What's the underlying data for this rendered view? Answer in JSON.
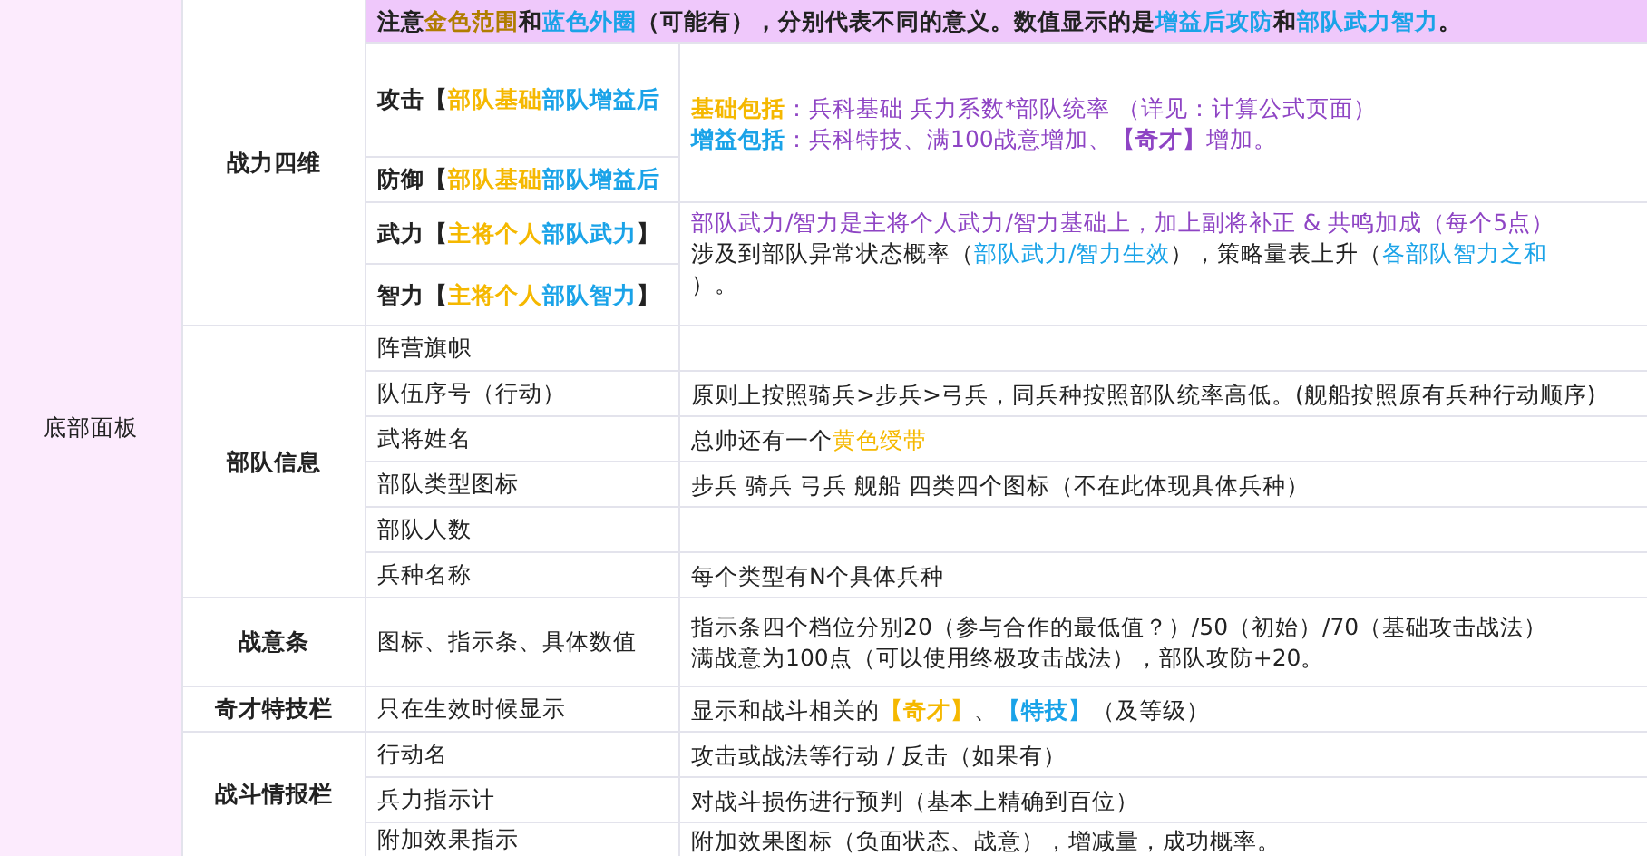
{
  "section": {
    "label": "底部面板"
  },
  "groups": [
    {
      "label": "战力四维",
      "note": [
        {
          "text": "注意",
          "color": "#222222",
          "bold": true
        },
        {
          "text": "金色范围",
          "color": "#b07d00",
          "bold": true
        },
        {
          "text": "和",
          "color": "#222222",
          "bold": true
        },
        {
          "text": "蓝色外圈",
          "color": "#1aa3e8",
          "bold": true
        },
        {
          "text": "（可能有），分别代表不同的意义。数值显示的是",
          "color": "#222222",
          "bold": true
        },
        {
          "text": "增益后攻防",
          "color": "#1aa3e8",
          "bold": true
        },
        {
          "text": "和",
          "color": "#222222",
          "bold": true
        },
        {
          "text": "部队武力智力",
          "color": "#1aa3e8",
          "bold": true
        },
        {
          "text": "。",
          "color": "#222222",
          "bold": true
        }
      ],
      "blocks": [
        {
          "items": [
            [
              {
                "text": "攻击【",
                "color": "#222222",
                "bold": true
              },
              {
                "text": "部队基础 ",
                "color": "#f5b800",
                "bold": true
              },
              {
                "text": "部队增益后",
                "color": "#1aa3e8",
                "bold": true
              }
            ],
            [
              {
                "text": "防御【",
                "color": "#222222",
                "bold": true
              },
              {
                "text": "部队基础 ",
                "color": "#f5b800",
                "bold": true
              },
              {
                "text": "部队增益后",
                "color": "#1aa3e8",
                "bold": true
              }
            ]
          ],
          "lines": [
            [
              {
                "text": "基础包括",
                "color": "#f5b800",
                "bold": true
              },
              {
                "text": "：兵科基础 兵力系数*部队统率 （详见：计算公式页面）",
                "color": "#8e44c4",
                "bold": false
              }
            ],
            [
              {
                "text": "增益包括",
                "color": "#1aa3e8",
                "bold": true
              },
              {
                "text": "：兵科特技、满100战意增加、",
                "color": "#8e44c4",
                "bold": false
              },
              {
                "text": "【奇才】",
                "color": "#8e44c4",
                "bold": true
              },
              {
                "text": "增加。",
                "color": "#8e44c4",
                "bold": false
              }
            ]
          ]
        },
        {
          "items": [
            [
              {
                "text": "武力【",
                "color": "#222222",
                "bold": true
              },
              {
                "text": "主将个人 ",
                "color": "#f5b800",
                "bold": true
              },
              {
                "text": "部队武力",
                "color": "#1aa3e8",
                "bold": true
              },
              {
                "text": "】",
                "color": "#222222",
                "bold": true
              }
            ],
            [
              {
                "text": "智力【",
                "color": "#222222",
                "bold": true
              },
              {
                "text": "主将个人 ",
                "color": "#f5b800",
                "bold": true
              },
              {
                "text": "部队智力",
                "color": "#1aa3e8",
                "bold": true
              },
              {
                "text": "】",
                "color": "#222222",
                "bold": true
              }
            ]
          ],
          "lines": [
            [
              {
                "text": "部队武力/智力是主将个人武力/智力基础上，加上副将补正 & 共鸣加成（每个5点）",
                "color": "#8e44c4",
                "bold": false
              }
            ],
            [
              {
                "text": "涉及到部队异常状态概率（",
                "color": "#222222",
                "bold": false
              },
              {
                "text": "部队武力/智力生效",
                "color": "#1aa3e8",
                "bold": false
              },
              {
                "text": "），策略量表上升（",
                "color": "#222222",
                "bold": false
              },
              {
                "text": "各部队智力之和",
                "color": "#1aa3e8",
                "bold": false
              }
            ],
            [
              {
                "text": "）。",
                "color": "#222222",
                "bold": false
              }
            ]
          ]
        }
      ]
    },
    {
      "label": "部队信息",
      "blocks": [
        {
          "items": [
            [
              {
                "text": "阵营旗帜",
                "color": "#222222",
                "bold": false
              }
            ]
          ]
        },
        {
          "items": [
            [
              {
                "text": "队伍序号（行动）",
                "color": "#222222",
                "bold": false
              }
            ]
          ],
          "lines": [
            [
              {
                "text": "原则上按照骑兵>步兵>弓兵，同兵种按照部队统率高低。(舰船按照原有兵种行动顺序)",
                "color": "#222222",
                "bold": false
              }
            ]
          ]
        },
        {
          "items": [
            [
              {
                "text": "武将姓名",
                "color": "#222222",
                "bold": false
              }
            ]
          ],
          "lines": [
            [
              {
                "text": "总帅还有一个",
                "color": "#222222",
                "bold": false
              },
              {
                "text": "黄色绶带",
                "color": "#f5b800",
                "bold": false
              }
            ]
          ]
        },
        {
          "items": [
            [
              {
                "text": "部队类型图标",
                "color": "#222222",
                "bold": false
              }
            ]
          ],
          "lines": [
            [
              {
                "text": "步兵 骑兵 弓兵 舰船 四类四个图标（不在此体现具体兵种）",
                "color": "#222222",
                "bold": false
              }
            ]
          ]
        },
        {
          "items": [
            [
              {
                "text": "部队人数",
                "color": "#222222",
                "bold": false
              }
            ]
          ]
        },
        {
          "items": [
            [
              {
                "text": "兵种名称",
                "color": "#222222",
                "bold": false
              }
            ]
          ],
          "lines": [
            [
              {
                "text": "每个类型有N个具体兵种",
                "color": "#222222",
                "bold": false
              }
            ]
          ]
        }
      ]
    },
    {
      "label": "战意条",
      "blocks": [
        {
          "items": [
            [
              {
                "text": "图标、指示条、具体数值",
                "color": "#222222",
                "bold": false
              }
            ]
          ],
          "lines": [
            [
              {
                "text": "指示条四个档位分别20（参与合作的最低值？）/50（初始）/70（基础攻击战法）",
                "color": "#222222",
                "bold": false
              }
            ],
            [
              {
                "text": "满战意为100点（可以使用终极攻击战法），部队攻防+20。",
                "color": "#222222",
                "bold": false
              }
            ]
          ]
        }
      ]
    },
    {
      "label": "奇才特技栏",
      "blocks": [
        {
          "items": [
            [
              {
                "text": "只在生效时候显示",
                "color": "#222222",
                "bold": false
              }
            ]
          ],
          "lines": [
            [
              {
                "text": "显示和战斗相关的",
                "color": "#222222",
                "bold": false
              },
              {
                "text": "【奇才】",
                "color": "#f5b800",
                "bold": true
              },
              {
                "text": "、",
                "color": "#222222",
                "bold": false
              },
              {
                "text": "【特技】",
                "color": "#1aa3e8",
                "bold": true
              },
              {
                "text": "（及等级）",
                "color": "#222222",
                "bold": false
              }
            ]
          ]
        }
      ]
    },
    {
      "label": "战斗情报栏",
      "blocks": [
        {
          "items": [
            [
              {
                "text": "行动名",
                "color": "#222222",
                "bold": false
              }
            ]
          ],
          "lines": [
            [
              {
                "text": "攻击或战法等行动 / 反击（如果有）",
                "color": "#222222",
                "bold": false
              }
            ]
          ]
        },
        {
          "items": [
            [
              {
                "text": "兵力指示计",
                "color": "#222222",
                "bold": false
              }
            ]
          ],
          "lines": [
            [
              {
                "text": "对战斗损伤进行预判（基本上精确到百位）",
                "color": "#222222",
                "bold": false
              }
            ]
          ]
        },
        {
          "items": [
            [
              {
                "text": "附加效果指示",
                "color": "#222222",
                "bold": false
              }
            ]
          ],
          "lines": [
            [
              {
                "text": "附加效果图标（负面状态、战意），增减量，成功概率。",
                "color": "#222222",
                "bold": false
              }
            ]
          ]
        }
      ]
    }
  ]
}
